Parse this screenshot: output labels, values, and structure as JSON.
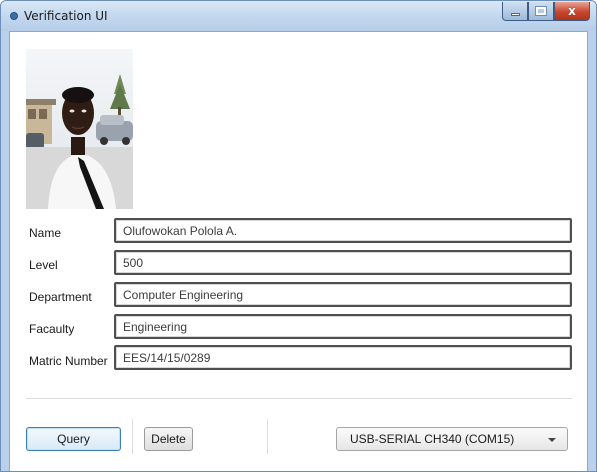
{
  "window": {
    "title": "Verification UI",
    "close_glyph": "x"
  },
  "student": {
    "fields": [
      {
        "label": "Name",
        "value": "Olufowokan Polola A."
      },
      {
        "label": "Level",
        "value": "500"
      },
      {
        "label": "Department",
        "value": "Computer Engineering"
      },
      {
        "label": "Facaulty",
        "value": "Engineering"
      },
      {
        "label": "Matric Number",
        "value": "EES/14/15/0289"
      }
    ]
  },
  "actions": {
    "query_label": "Query",
    "delete_label": "Delete"
  },
  "port": {
    "selected": "USB-SERIAL CH340 (COM15)"
  },
  "icons": {
    "app": "app-icon",
    "minimize": "minimize-icon",
    "maximize": "maximize-icon",
    "close": "close-icon",
    "dropdown": "chevron-down-icon"
  },
  "colors": {
    "title_bar": "#c5d9ef",
    "close_button": "#c7462d",
    "focus_button_border": "#3c7fb1",
    "field_border": "#4f4f4f"
  }
}
